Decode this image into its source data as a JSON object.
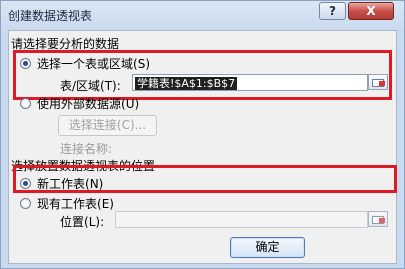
{
  "window": {
    "title": "创建数据透视表",
    "help_label": "?",
    "close_label": "X"
  },
  "data_source": {
    "heading": "请选择要分析的数据",
    "option_table": "选择一个表或区域",
    "option_table_key": "(S)",
    "range_label": "表/区域",
    "range_label_key": "(T):",
    "range_value": "学籍表!$A$1:$B$7",
    "option_external": "使用外部数据源",
    "option_external_key": "(U)",
    "choose_connection": "选择连接(C)...",
    "connection_name_label": "连接名称:"
  },
  "placement": {
    "heading": "选择放置数据透视表的位置",
    "option_new": "新工作表",
    "option_new_key": "(N)",
    "option_existing": "现有工作表",
    "option_existing_key": "(E)",
    "location_label": "位置",
    "location_label_key": "(L):",
    "location_value": ""
  },
  "buttons": {
    "ok": "确定"
  },
  "state": {
    "selected_source": "table",
    "selected_placement": "new"
  },
  "colors": {
    "highlight": "#e01a24",
    "close_button": "#c75050"
  }
}
